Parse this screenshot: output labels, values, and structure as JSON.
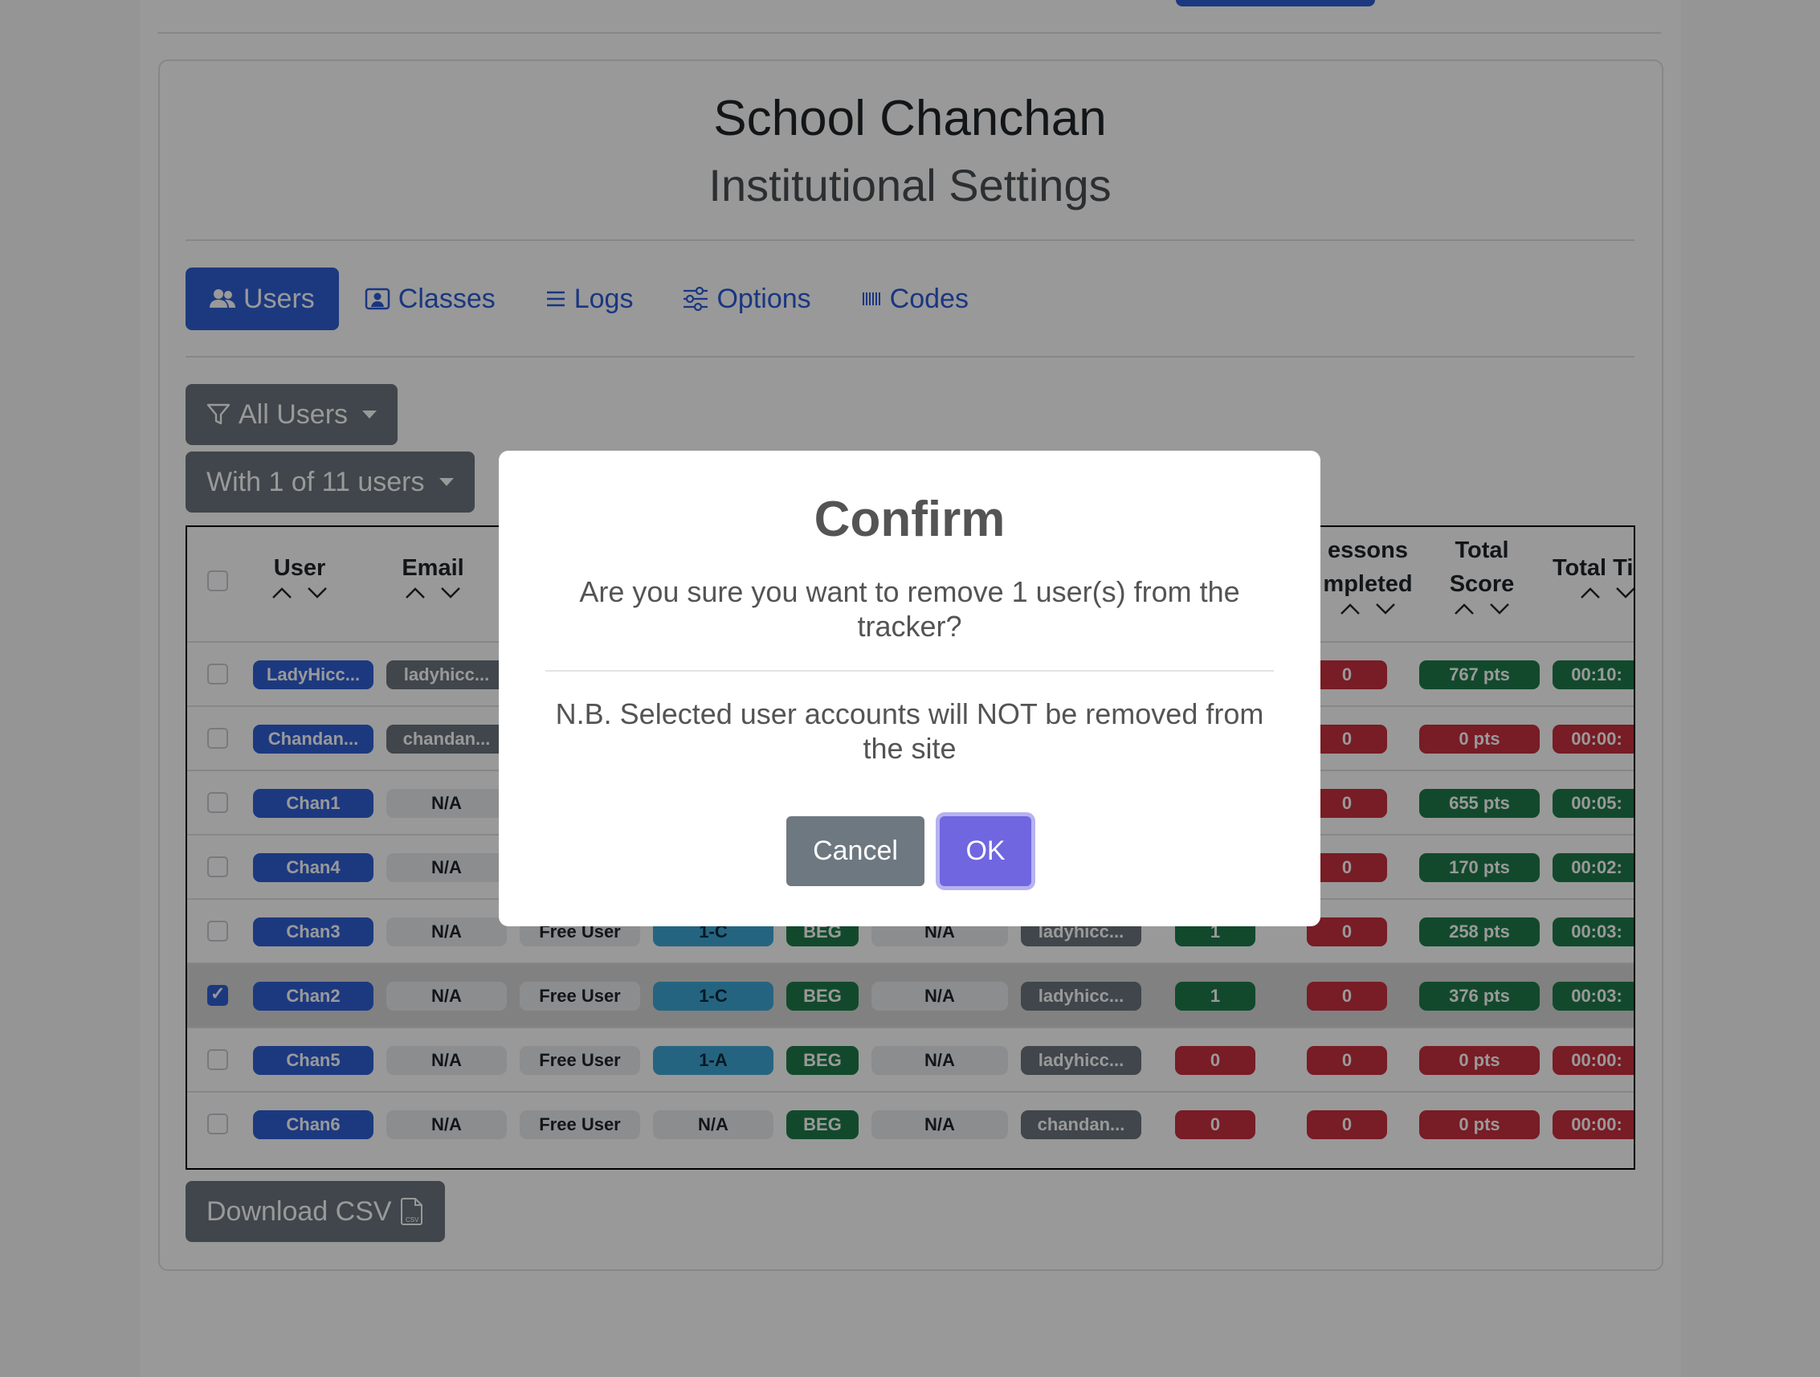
{
  "header": {
    "school_name": "School Chanchan",
    "subtitle": "Institutional Settings"
  },
  "tabs": [
    {
      "label": "Users",
      "icon": "users-icon",
      "active": true
    },
    {
      "label": "Classes",
      "icon": "classes-icon",
      "active": false
    },
    {
      "label": "Logs",
      "icon": "logs-icon",
      "active": false
    },
    {
      "label": "Options",
      "icon": "options-icon",
      "active": false
    },
    {
      "label": "Codes",
      "icon": "codes-icon",
      "active": false
    }
  ],
  "filters": {
    "filter_label": "All Users",
    "selection_label": "With 1 of 11 users"
  },
  "table": {
    "headers": {
      "user": "User",
      "email": "Email",
      "lessons_line1": "essons",
      "lessons_line2": "mpleted",
      "score_line1": "Total",
      "score_line2": "Score",
      "time": "Total Ti"
    },
    "rows": [
      {
        "checked": false,
        "user": "LadyHicc...",
        "email": "ladyhicc...",
        "type": "",
        "cls": "",
        "level": "",
        "extra": "",
        "creator": "",
        "count": "",
        "lessons": "0",
        "score": "767 pts",
        "time": "00:10:",
        "score_color": "green",
        "time_color": "green"
      },
      {
        "checked": false,
        "user": "Chandan...",
        "email": "chandan...",
        "type": "",
        "cls": "",
        "level": "",
        "extra": "",
        "creator": "",
        "count": "",
        "lessons": "0",
        "score": "0 pts",
        "time": "00:00:",
        "score_color": "red",
        "time_color": "red"
      },
      {
        "checked": false,
        "user": "Chan1",
        "email": "N/A",
        "type": "",
        "cls": "",
        "level": "",
        "extra": "",
        "creator": "",
        "count": "",
        "lessons": "0",
        "score": "655 pts",
        "time": "00:05:",
        "score_color": "green",
        "time_color": "green"
      },
      {
        "checked": false,
        "user": "Chan4",
        "email": "N/A",
        "type": "",
        "cls": "",
        "level": "",
        "extra": "",
        "creator": "",
        "count": "",
        "lessons": "0",
        "score": "170 pts",
        "time": "00:02:",
        "score_color": "green",
        "time_color": "green"
      },
      {
        "checked": false,
        "user": "Chan3",
        "email": "N/A",
        "type": "Free User",
        "cls": "1-C",
        "level": "BEG",
        "extra": "N/A",
        "creator": "ladyhicc...",
        "count": "1",
        "lessons": "0",
        "score": "258 pts",
        "time": "00:03:",
        "score_color": "green",
        "time_color": "green"
      },
      {
        "checked": true,
        "user": "Chan2",
        "email": "N/A",
        "type": "Free User",
        "cls": "1-C",
        "level": "BEG",
        "extra": "N/A",
        "creator": "ladyhicc...",
        "count": "1",
        "lessons": "0",
        "score": "376 pts",
        "time": "00:03:",
        "score_color": "green",
        "time_color": "green"
      },
      {
        "checked": false,
        "user": "Chan5",
        "email": "N/A",
        "type": "Free User",
        "cls": "1-A",
        "level": "BEG",
        "extra": "N/A",
        "creator": "ladyhicc...",
        "count": "0",
        "lessons": "0",
        "score": "0 pts",
        "time": "00:00:",
        "score_color": "red",
        "time_color": "red"
      },
      {
        "checked": false,
        "user": "Chan6",
        "email": "N/A",
        "type": "Free User",
        "cls": "N/A",
        "level": "BEG",
        "extra": "N/A",
        "creator": "chandan...",
        "count": "0",
        "lessons": "0",
        "score": "0 pts",
        "time": "00:00:",
        "score_color": "red",
        "time_color": "red"
      }
    ]
  },
  "download": {
    "label": "Download CSV",
    "icon": "csv-file-icon"
  },
  "modal": {
    "title": "Confirm",
    "question": "Are you sure you want to remove 1 user(s) from the tracker?",
    "note": "N.B. Selected user accounts will NOT be removed from the site",
    "cancel_label": "Cancel",
    "ok_label": "OK"
  },
  "colors": {
    "primary": "#2f5fd6",
    "secondary": "#6c757d",
    "success": "#1f7a4a",
    "danger": "#c9303e",
    "info": "#3fa7d6",
    "confirm": "#7066e0"
  }
}
